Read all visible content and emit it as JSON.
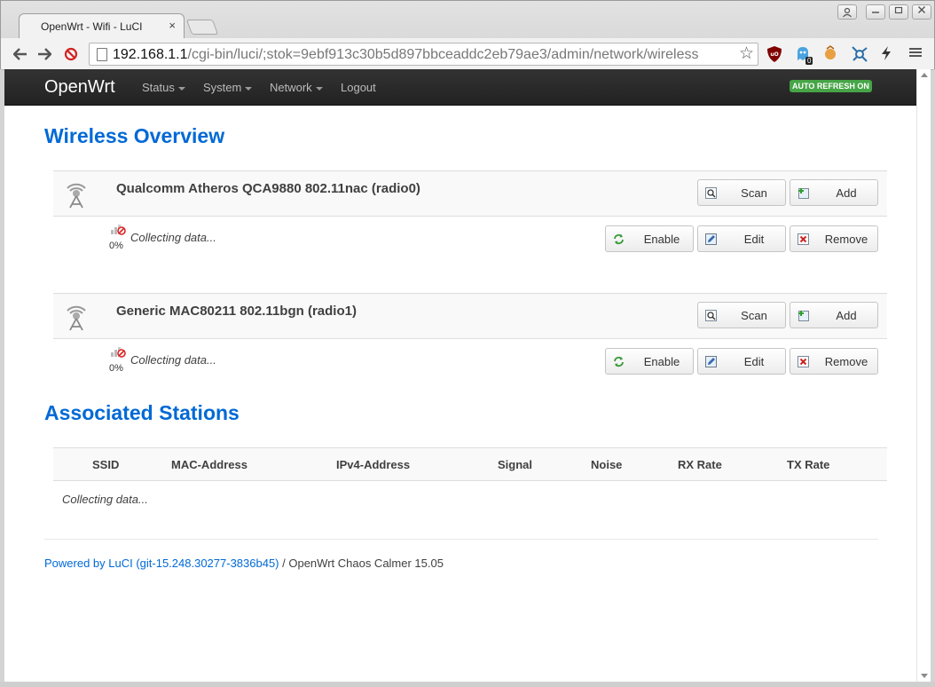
{
  "browser": {
    "tab_title": "OpenWrt - Wifi - LuCI",
    "tab_close": "×",
    "url_host": "192.168.1.1",
    "url_path": "/cgi-bin/luci/;stok=9ebf913c30b5d897bbceaddc2eb79ae3/admin/network/wireless",
    "ext_badge_count": "0"
  },
  "navbar": {
    "brand": "OpenWrt",
    "menu": [
      "Status",
      "System",
      "Network",
      "Logout"
    ],
    "auto_refresh": "AUTO REFRESH ON"
  },
  "wireless_overview": {
    "title": "Wireless Overview",
    "radios": [
      {
        "name": "Qualcomm Atheros QCA9880 802.11nac (radio0)",
        "signal": "0%",
        "status": "Collecting data..."
      },
      {
        "name": "Generic MAC80211 802.11bgn (radio1)",
        "signal": "0%",
        "status": "Collecting data..."
      }
    ],
    "buttons": {
      "scan": "Scan",
      "add": "Add",
      "enable": "Enable",
      "edit": "Edit",
      "remove": "Remove"
    }
  },
  "stations": {
    "title": "Associated Stations",
    "columns": [
      "SSID",
      "MAC-Address",
      "IPv4-Address",
      "Signal",
      "Noise",
      "RX Rate",
      "TX Rate"
    ],
    "empty": "Collecting data..."
  },
  "footer": {
    "link": "Powered by LuCI (git-15.248.30277-3836b45)",
    "text": " / OpenWrt Chaos Calmer 15.05"
  },
  "colors": {
    "accent": "#0069d6",
    "navbar": "#222222",
    "badge": "#46a546"
  }
}
